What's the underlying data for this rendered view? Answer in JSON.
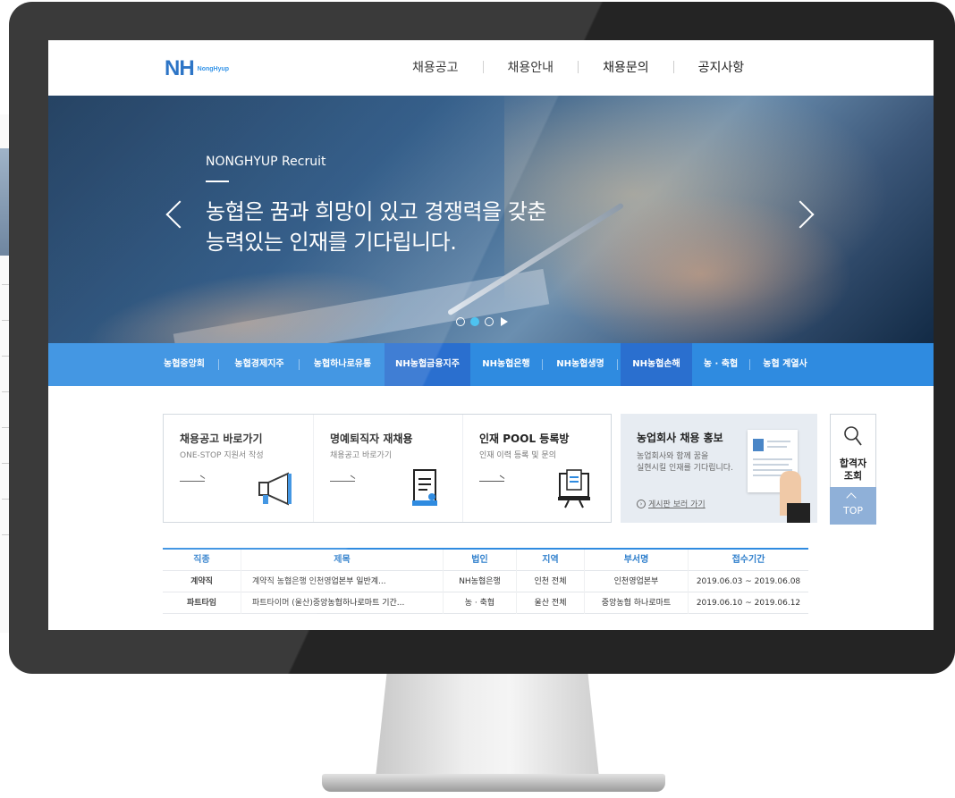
{
  "header": {
    "logo_mark": "NH",
    "logo_sub": "NongHyup",
    "nav": [
      "채용공고",
      "채용안내",
      "채용문의",
      "공지사항"
    ]
  },
  "hero": {
    "subtitle": "NONGHYUP Recruit",
    "title_line1": "농협은 꿈과 희망이 있고 경쟁력을 갖춘",
    "title_line2": "능력있는 인재를 기다립니다.",
    "slides_total": 3,
    "slide_active_index": 2
  },
  "family": {
    "items": [
      "농협중앙회",
      "농협경제지주",
      "농협하나로유통",
      "NH농협금융지주",
      "NH농협은행",
      "NH농협생명",
      "NH농협손해",
      "농 · 축협",
      "농협 계열사"
    ],
    "active": [
      "NH농협금융지주",
      "NH농협손해"
    ]
  },
  "quick": [
    {
      "title": "채용공고 바로가기",
      "desc": "ONE-STOP 지원서 작성",
      "icon": "megaphone-icon"
    },
    {
      "title": "명예퇴직자 재채용",
      "desc": "채용공고 바로가기",
      "icon": "document-icon"
    },
    {
      "title": "인재 POOL 등록방",
      "desc": "인재 이력 등록 및 문의",
      "icon": "computer-icon"
    }
  ],
  "promo": {
    "title": "농업회사 채용 홍보",
    "desc_line1": "농업회사와 함께 꿈을",
    "desc_line2": "실현시킬 인재를 기다립니다.",
    "link": "게시판 보러 가기"
  },
  "side": {
    "label_line1": "합격자",
    "label_line2": "조회",
    "top": "TOP"
  },
  "table": {
    "headers": [
      "직종",
      "제목",
      "법인",
      "지역",
      "부서명",
      "접수기간"
    ],
    "rows": [
      [
        "계약직",
        "계약직 농협은행 인천영업본부 일반계...",
        "NH농협은행",
        "인천 전체",
        "인천영업본부",
        "2019.06.03 ~ 2019.06.08"
      ],
      [
        "파트타임",
        "파트타이머 (울산)중앙농협하나로마트 기간...",
        "농 · 축협",
        "울산 전체",
        "중앙농협 하나로마트",
        "2019.06.10 ~ 2019.06.12"
      ]
    ]
  },
  "colors": {
    "brand_blue": "#1565c0",
    "family_bar": "#2f8be0",
    "family_active": "#2a6fcf",
    "dot_active": "#4ec3f0",
    "top_button": "#8fb0d8",
    "monitor_frame": "#242424"
  }
}
